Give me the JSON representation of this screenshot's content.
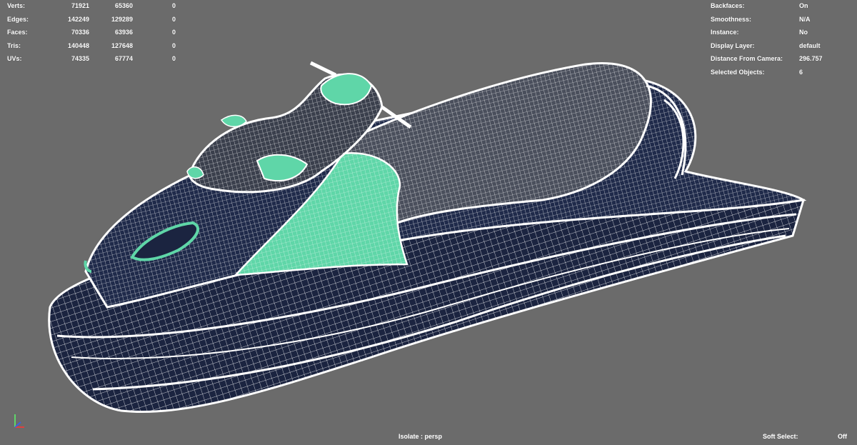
{
  "stats": {
    "rows": [
      {
        "label": "Verts:",
        "v1": "71921",
        "v2": "65360",
        "v3": "0"
      },
      {
        "label": "Edges:",
        "v1": "142249",
        "v2": "129289",
        "v3": "0"
      },
      {
        "label": "Faces:",
        "v1": "70336",
        "v2": "63936",
        "v3": "0"
      },
      {
        "label": "Tris:",
        "v1": "140448",
        "v2": "127648",
        "v3": "0"
      },
      {
        "label": "UVs:",
        "v1": "74335",
        "v2": "67774",
        "v3": "0"
      }
    ]
  },
  "info": {
    "rows": [
      {
        "label": "Backfaces:",
        "value": "On"
      },
      {
        "label": "Smoothness:",
        "value": "N/A"
      },
      {
        "label": "Instance:",
        "value": "No"
      },
      {
        "label": "Display Layer:",
        "value": "default"
      },
      {
        "label": "Distance From Camera:",
        "value": "296.757"
      },
      {
        "label": "Selected Objects:",
        "value": "6"
      }
    ]
  },
  "footer": {
    "isolate": "Isolate : persp",
    "soft_select_label": "Soft Select:",
    "soft_select_value": "Off"
  },
  "colors": {
    "background": "#6b6b6b",
    "wire": "#ffffff",
    "hull": "#1b2440",
    "selected": "#5fd6a8"
  },
  "icons": {
    "axis": "view-axis-gizmo-icon"
  }
}
